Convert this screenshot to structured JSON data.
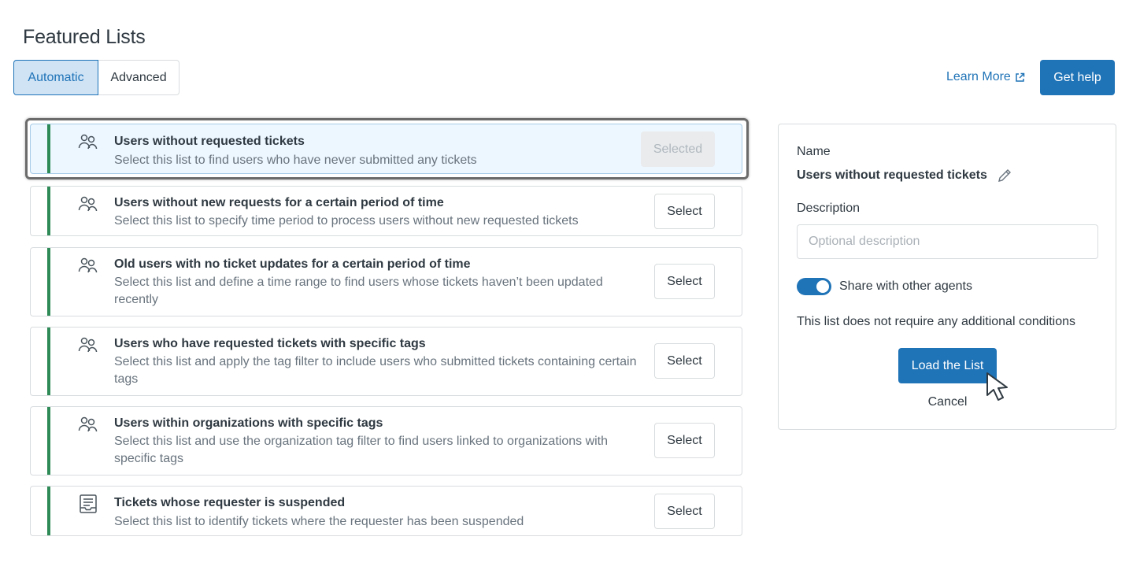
{
  "page": {
    "title": "Featured Lists"
  },
  "mode_tabs": [
    {
      "label": "Automatic",
      "active": true
    },
    {
      "label": "Advanced",
      "active": false
    }
  ],
  "header": {
    "learn_more": "Learn More",
    "get_help": "Get help"
  },
  "lists": [
    {
      "title": "Users without requested tickets",
      "description": "Select this list to find users who have never submitted any tickets",
      "button": "Selected",
      "icon": "users-icon",
      "selected": true
    },
    {
      "title": "Users without new requests for a certain period of time",
      "description": "Select this list to specify time period to process users without new requested tickets",
      "button": "Select",
      "icon": "users-icon"
    },
    {
      "title": "Old users with no ticket updates for a certain period of time",
      "description": "Select this list and define a time range to find users whose tickets haven’t been updated recently",
      "button": "Select",
      "icon": "users-icon"
    },
    {
      "title": "Users who have requested tickets with specific tags",
      "description": "Select this list and apply the tag filter to include users who submitted tickets containing certain tags",
      "button": "Select",
      "icon": "users-icon"
    },
    {
      "title": "Users within organizations with specific tags",
      "description": "Select this list and use the organization tag filter to find users linked to organizations with specific tags",
      "button": "Select",
      "icon": "users-icon"
    },
    {
      "title": "Tickets whose requester is suspended",
      "description": "Select this list to identify tickets where the requester has been suspended",
      "button": "Select",
      "icon": "inbox-icon"
    }
  ],
  "panel": {
    "name_label": "Name",
    "name_value": "Users without requested tickets",
    "description_label": "Description",
    "description_value": "",
    "description_placeholder": "Optional description",
    "share_label": "Share with other agents",
    "share_enabled": true,
    "conditions_text": "This list does not require any additional conditions",
    "load_button": "Load the List",
    "cancel_button": "Cancel"
  },
  "colors": {
    "accent": "#1f73b7",
    "stripe": "#2e8b57",
    "selected_bg": "#edf7ff"
  }
}
